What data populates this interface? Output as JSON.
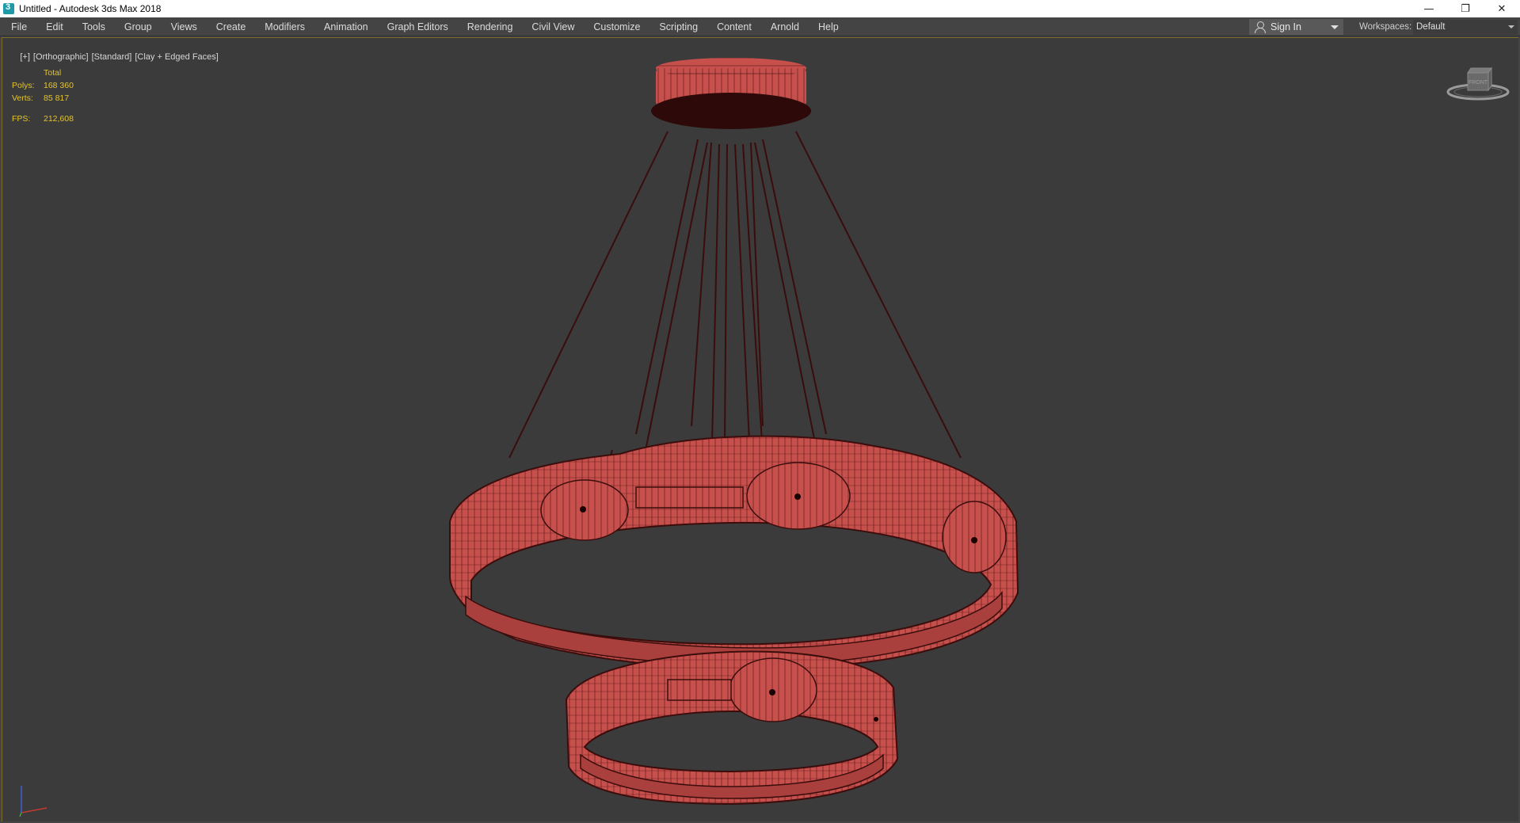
{
  "window": {
    "title": "Untitled - Autodesk 3ds Max 2018",
    "minimize": "—",
    "restore": "❐",
    "close": "✕"
  },
  "menu": {
    "items": [
      "File",
      "Edit",
      "Tools",
      "Group",
      "Views",
      "Create",
      "Modifiers",
      "Animation",
      "Graph Editors",
      "Rendering",
      "Civil View",
      "Customize",
      "Scripting",
      "Content",
      "Arnold",
      "Help"
    ],
    "sign_in": "Sign In",
    "workspaces_label": "Workspaces:",
    "workspaces_value": "Default"
  },
  "viewport": {
    "labels": [
      "[+]",
      "[Orthographic]",
      "[Standard]",
      "[Clay + Edged Faces]"
    ],
    "stats": {
      "header": "Total",
      "polys_label": "Polys:",
      "polys_value": "168 360",
      "verts_label": "Verts:",
      "verts_value": "85 817",
      "fps_label": "FPS:",
      "fps_value": "212,608"
    },
    "viewcube_label": "FRONT",
    "icons": [
      "viewcube-icon",
      "axis-tripod-icon"
    ]
  },
  "colors": {
    "viewport_bg": "#3b3b3b",
    "model_fill": "#c8504c",
    "model_wire": "#3a0d0c",
    "stats_text": "#e4c52e",
    "frame_highlight": "#7a6a2c"
  }
}
